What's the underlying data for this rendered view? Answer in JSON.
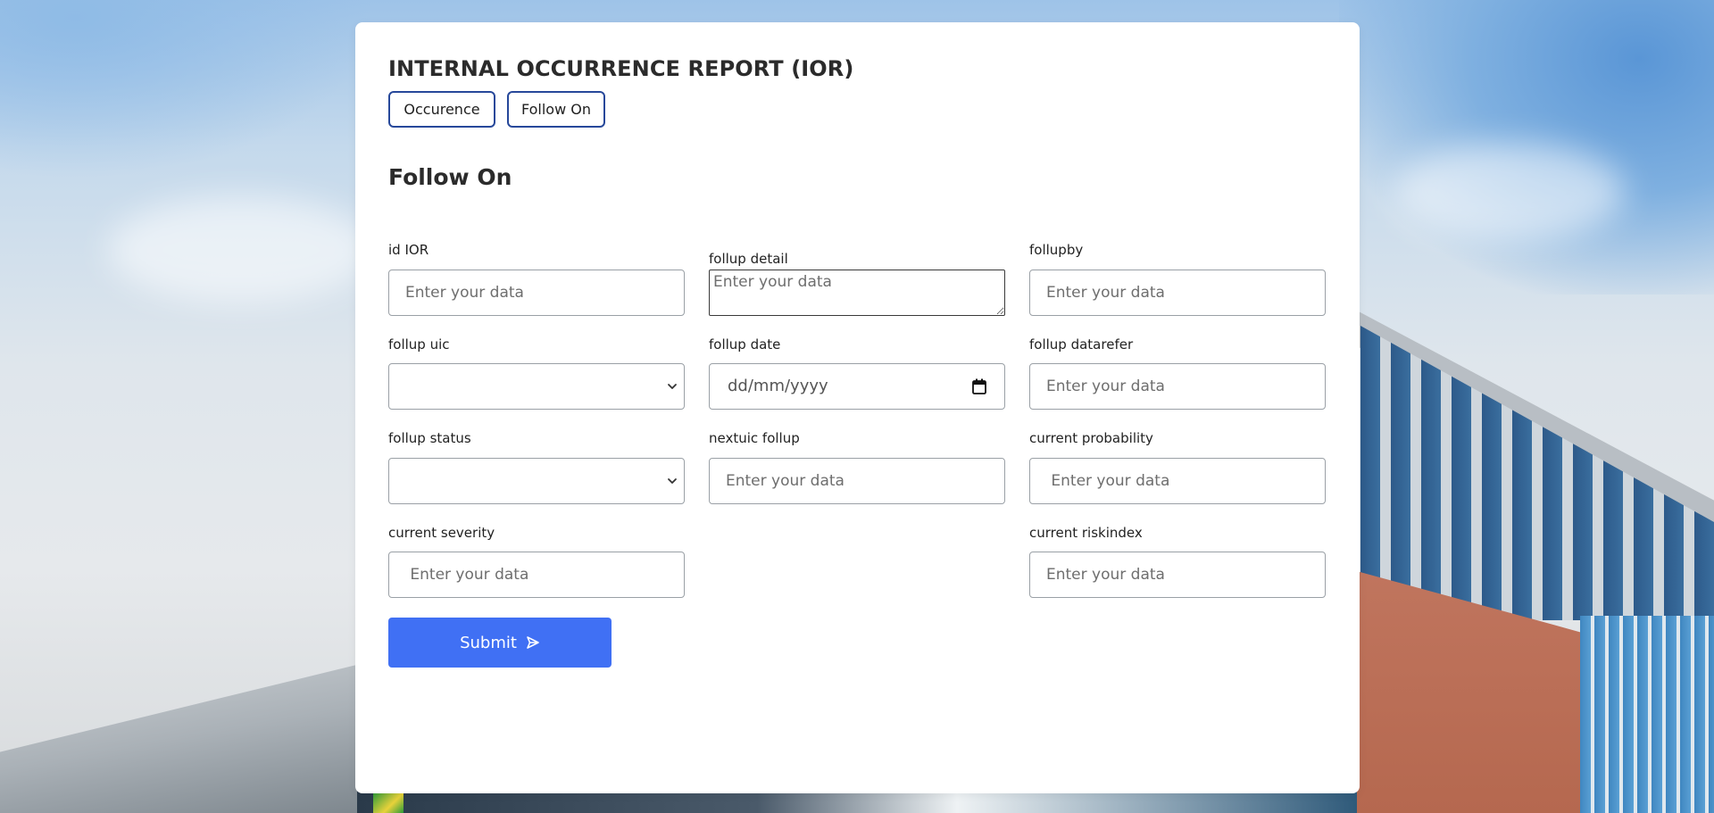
{
  "header": {
    "title": "INTERNAL OCCURRENCE REPORT (IOR)",
    "tabs": [
      {
        "label": "Occurence"
      },
      {
        "label": "Follow On"
      }
    ]
  },
  "section": {
    "title": "Follow On"
  },
  "form": {
    "id_ior": {
      "label": "id IOR",
      "placeholder": "Enter your data",
      "value": ""
    },
    "follup_detail": {
      "label": "follup detail",
      "placeholder": "Enter your data",
      "value": ""
    },
    "follupby": {
      "label": "follupby",
      "placeholder": "Enter your data",
      "value": ""
    },
    "follup_uic": {
      "label": "follup uic",
      "selected": ""
    },
    "follup_date": {
      "label": "follup date",
      "placeholder": "dd/mm/yyyy"
    },
    "follup_datarefer": {
      "label": "follup datarefer",
      "placeholder": "Enter your data",
      "value": ""
    },
    "follup_status": {
      "label": "follup status",
      "selected": ""
    },
    "nextuic_follup": {
      "label": "nextuic follup",
      "placeholder": "Enter your data",
      "value": ""
    },
    "current_probability": {
      "label": "current probability",
      "placeholder": " Enter your data",
      "value": ""
    },
    "current_severity": {
      "label": "current severity",
      "placeholder": " Enter your data",
      "value": ""
    },
    "current_riskindex": {
      "label": "current riskindex",
      "placeholder": "Enter your data",
      "value": ""
    }
  },
  "actions": {
    "submit_label": "Submit",
    "submit_icon": "send-icon"
  },
  "colors": {
    "accent": "#4070f4",
    "tab_border": "#27489a",
    "card_bg": "#ffffff"
  }
}
